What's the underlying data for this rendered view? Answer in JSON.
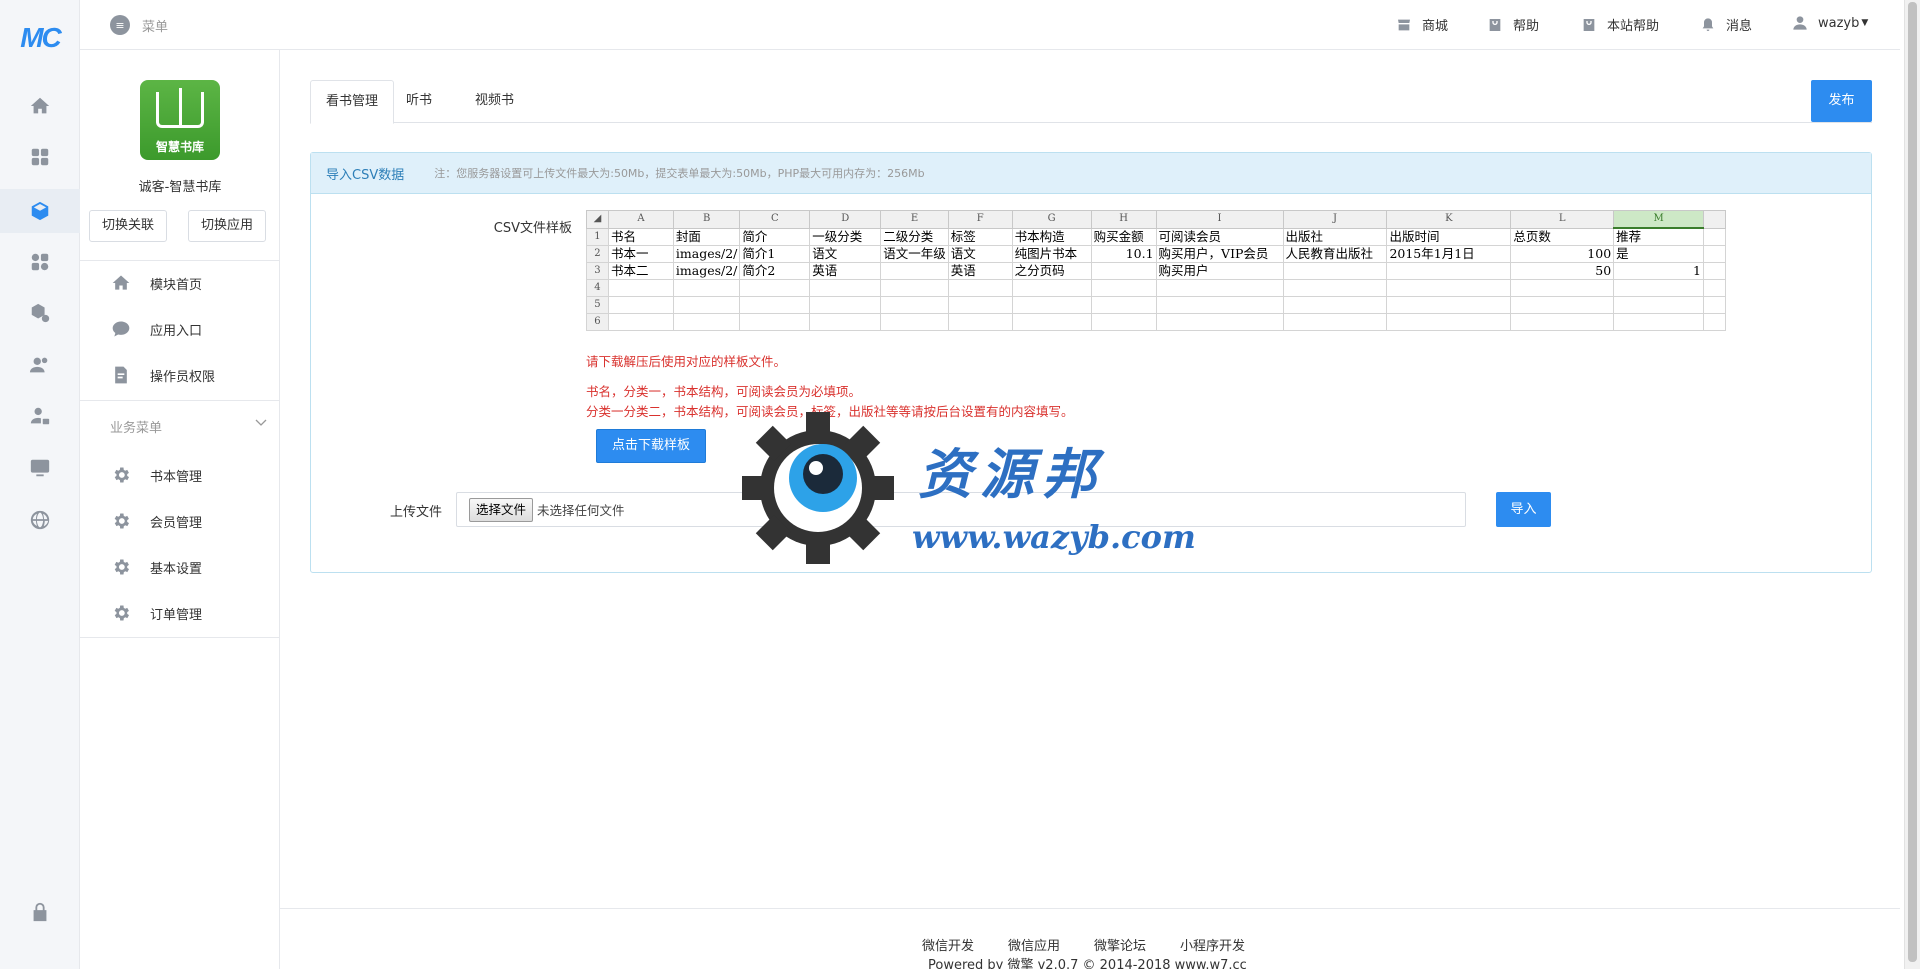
{
  "rail": {
    "logo": "MC"
  },
  "topbar": {
    "menu_label": "菜单",
    "nav": [
      {
        "icon": "store-icon",
        "label": "商城"
      },
      {
        "icon": "help-icon",
        "label": "帮助"
      },
      {
        "icon": "site-help-icon",
        "label": "本站帮助"
      },
      {
        "icon": "bell-icon",
        "label": "消息"
      },
      {
        "icon": "user-icon",
        "label": "wazyb"
      }
    ]
  },
  "sidebar": {
    "app_logo_text": "智慧书库",
    "app_name": "诚客-智慧书库",
    "switch_link_label": "切换关联",
    "switch_app_label": "切换应用",
    "items": [
      {
        "icon": "home-icon",
        "label": "模块首页"
      },
      {
        "icon": "chat-icon",
        "label": "应用入口"
      },
      {
        "icon": "document-icon",
        "label": "操作员权限"
      }
    ],
    "group_title": "业务菜单",
    "business_items": [
      {
        "icon": "gear-icon",
        "label": "书本管理"
      },
      {
        "icon": "gear-icon",
        "label": "会员管理"
      },
      {
        "icon": "gear-icon",
        "label": "基本设置"
      },
      {
        "icon": "gear-icon",
        "label": "订单管理"
      }
    ]
  },
  "main": {
    "tabs": [
      "看书管理",
      "听书",
      "视频书"
    ],
    "active_tab": 0,
    "publish_label": "发布",
    "panel": {
      "title": "导入CSV数据",
      "note": "注：您服务器设置可上传文件最大为:50Mb，提交表单最大为:50Mb，PHP最大可用内存为：256Mb",
      "csv_sample_label": "CSV文件样板",
      "sheet": {
        "columns": [
          "A",
          "B",
          "C",
          "D",
          "E",
          "F",
          "G",
          "H",
          "I",
          "J",
          "K",
          "L",
          "M"
        ],
        "selected_column": "M",
        "rows": [
          [
            "书名",
            "封面",
            "简介",
            "一级分类",
            "二级分类",
            "标签",
            "书本构造",
            "购买金额",
            "可阅读会员",
            "出版社",
            "出版时间",
            "总页数",
            "推荐"
          ],
          [
            "书本一",
            "images/2/",
            "简介1",
            "语文",
            "语文一年级",
            "语文",
            "纯图片书本",
            "10.1",
            "购买用户，VIP会员",
            "人民教育出版社",
            "2015年1月1日",
            "100",
            "是"
          ],
          [
            "书本二",
            "images/2/",
            "简介2",
            "英语",
            "",
            "英语",
            "之分页码",
            "",
            "购买用户",
            "",
            "",
            "50",
            "1"
          ],
          [
            "",
            "",
            "",
            "",
            "",
            "",
            "",
            "",
            "",
            "",
            "",
            "",
            ""
          ],
          [
            "",
            "",
            "",
            "",
            "",
            "",
            "",
            "",
            "",
            "",
            "",
            "",
            ""
          ],
          [
            "",
            "",
            "",
            "",
            "",
            "",
            "",
            "",
            "",
            "",
            "",
            "",
            ""
          ]
        ]
      },
      "hint_1": "请下载解压后使用对应的样板文件。",
      "hint_2": "书名，分类一，书本结构，可阅读会员为必填项。",
      "hint_3": "分类一分类二，书本结构，可阅读会员，标签，出版社等等请按后台设置有的内容填写。",
      "download_label": "点击下载样板",
      "upload_label": "上传文件",
      "choose_file_label": "选择文件",
      "no_file_label": "未选择任何文件",
      "import_label": "导入"
    }
  },
  "watermark": {
    "title": "资源邦",
    "url": "www.wazyb.com"
  },
  "footer": {
    "links": [
      "微信开发",
      "微信应用",
      "微擎论坛",
      "小程序开发"
    ],
    "powered": "Powered by 微擎 v2.0.7 © 2014-2018 www.w7.cc"
  },
  "colors": {
    "accent": "#2d8cf0",
    "warning_text": "#d9322e",
    "panel_head": "#dff0fa"
  }
}
